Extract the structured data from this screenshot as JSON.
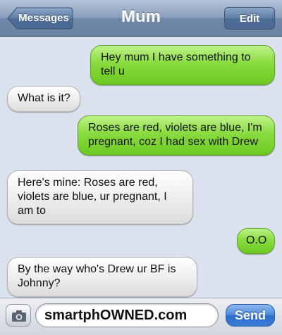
{
  "header": {
    "back_label": "Messages",
    "title": "Mum",
    "edit_label": "Edit"
  },
  "messages": [
    {
      "direction": "outgoing",
      "text": "Hey mum I have something to tell u"
    },
    {
      "direction": "incoming",
      "text": "What is it?"
    },
    {
      "direction": "outgoing",
      "text": "Roses are red, violets are blue, I'm pregnant, coz I had sex with Drew"
    },
    {
      "direction": "incoming",
      "text": "Here's mine: Roses are red, violets are blue, ur pregnant, I am to"
    },
    {
      "direction": "outgoing",
      "text": "O.O"
    },
    {
      "direction": "incoming",
      "text": "By the way who's Drew ur BF is Johnny?"
    }
  ],
  "composer": {
    "input_value": "smartphOWNED.com",
    "send_label": "Send"
  },
  "colors": {
    "outgoing_bubble": "#89db3f",
    "incoming_bubble": "#ececec",
    "thread_background": "#dbe2ed",
    "send_button": "#3a7bd6"
  },
  "icons": {
    "camera": "camera-icon",
    "back": "back-arrow"
  }
}
